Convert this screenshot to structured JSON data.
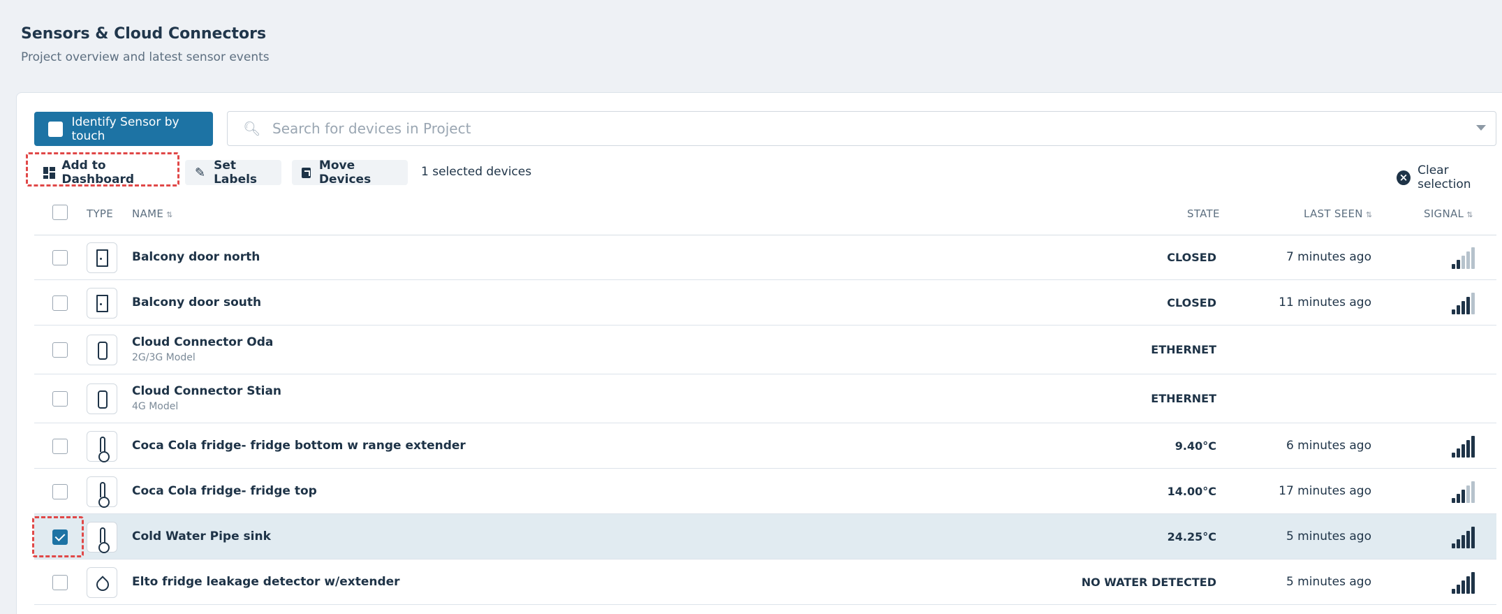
{
  "header": {
    "title": "Sensors & Cloud Connectors",
    "subtitle": "Project overview and latest sensor events"
  },
  "toolbar": {
    "identify_label": "Identify Sensor by touch",
    "search_placeholder": "Search for devices in Project",
    "add_dashboard_label": "Add to Dashboard",
    "set_labels_label": "Set Labels",
    "move_devices_label": "Move Devices",
    "selected_count": "1 selected devices",
    "clear_selection_label": "Clear selection"
  },
  "table": {
    "columns": {
      "type": "TYPE",
      "name": "NAME",
      "state": "STATE",
      "last_seen": "LAST SEEN",
      "signal": "SIGNAL"
    },
    "rows": [
      {
        "name": "Balcony door north",
        "model": "",
        "state": "CLOSED",
        "last_seen": "7 minutes ago",
        "icon": "door-icon",
        "signal_bars": 2,
        "selected": false
      },
      {
        "name": "Balcony door south",
        "model": "",
        "state": "CLOSED",
        "last_seen": "11 minutes ago",
        "icon": "door-icon",
        "signal_bars": 4,
        "selected": false
      },
      {
        "name": "Cloud Connector Oda",
        "model": "2G/3G Model",
        "state": "ETHERNET",
        "last_seen": "",
        "icon": "cloud-connector-icon",
        "signal_bars": 0,
        "selected": false
      },
      {
        "name": "Cloud Connector Stian",
        "model": "4G Model",
        "state": "ETHERNET",
        "last_seen": "",
        "icon": "cloud-connector-icon",
        "signal_bars": 0,
        "selected": false
      },
      {
        "name": "Coca Cola fridge- fridge bottom w range extender",
        "model": "",
        "state": "9.40°C",
        "last_seen": "6 minutes ago",
        "icon": "thermometer-icon",
        "signal_bars": 5,
        "selected": false
      },
      {
        "name": "Coca Cola fridge- fridge top",
        "model": "",
        "state": "14.00°C",
        "last_seen": "17 minutes ago",
        "icon": "thermometer-icon",
        "signal_bars": 3,
        "selected": false
      },
      {
        "name": "Cold Water Pipe sink",
        "model": "",
        "state": "24.25°C",
        "last_seen": "5 minutes ago",
        "icon": "thermometer-icon",
        "signal_bars": 5,
        "selected": true
      },
      {
        "name": "Elto fridge leakage detector w/extender",
        "model": "",
        "state": "NO WATER DETECTED",
        "last_seen": "5 minutes ago",
        "icon": "water-drop-icon",
        "signal_bars": 5,
        "selected": false
      }
    ]
  },
  "colors": {
    "accent": "#1d73a4",
    "highlight": "#e04848",
    "selected_row": "#e1ebf1"
  }
}
